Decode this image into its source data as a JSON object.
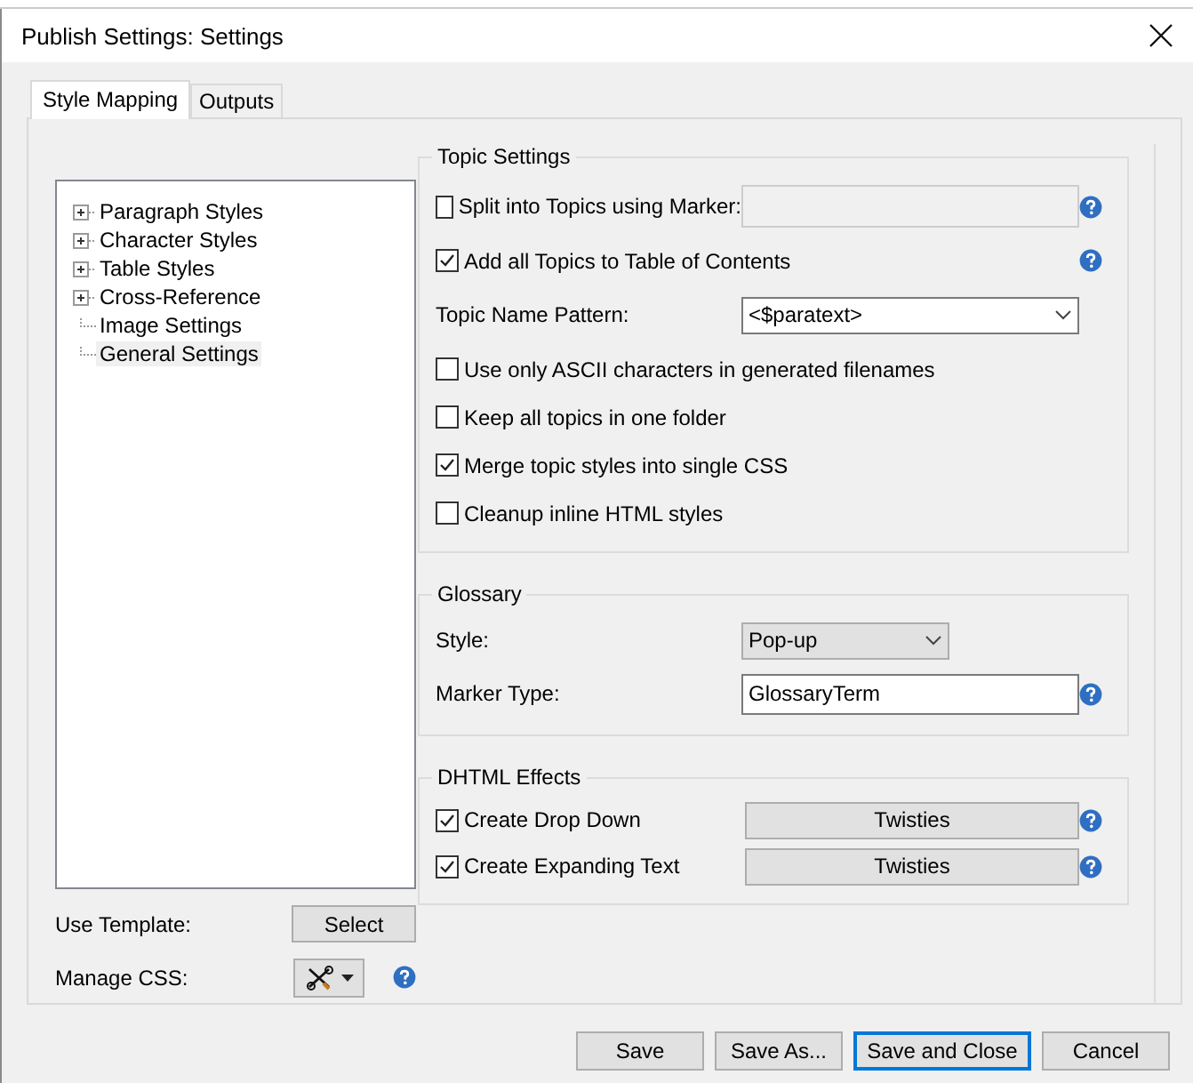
{
  "window": {
    "title": "Publish Settings: Settings"
  },
  "tabs": [
    {
      "label": "Style Mapping",
      "selected": true
    },
    {
      "label": "Outputs",
      "selected": false
    }
  ],
  "tree": {
    "items": [
      {
        "label": "Paragraph Styles",
        "kind": "group",
        "expanded": false,
        "selected": false
      },
      {
        "label": "Character Styles",
        "kind": "group",
        "expanded": false,
        "selected": false
      },
      {
        "label": "Table Styles",
        "kind": "group",
        "expanded": false,
        "selected": false
      },
      {
        "label": "Cross-Reference",
        "kind": "group",
        "expanded": false,
        "selected": false
      },
      {
        "label": "Image Settings",
        "kind": "leaf",
        "selected": false
      },
      {
        "label": "General Settings",
        "kind": "leaf",
        "selected": true
      }
    ]
  },
  "template": {
    "label": "Use Template:",
    "button": "Select"
  },
  "manage_css": {
    "label": "Manage CSS:",
    "help": true
  },
  "groups": [
    {
      "title": "Topic Settings",
      "rows": [
        {
          "kind": "checkbox",
          "label": "Split into Topics using Marker:",
          "checked": false,
          "field": {
            "disabled": true
          },
          "help": true
        },
        {
          "kind": "checkbox",
          "label": "Add all Topics to Table of Contents",
          "checked": true,
          "help": true
        },
        {
          "kind": "combo",
          "label": "Topic Name Pattern:",
          "value": "<$paratext>"
        },
        {
          "kind": "checkbox",
          "label": "Use only ASCII characters in generated filenames",
          "checked": false
        },
        {
          "kind": "checkbox",
          "label": "Keep all topics in one folder",
          "checked": false
        },
        {
          "kind": "checkbox",
          "label": "Merge topic styles into single CSS",
          "checked": true
        },
        {
          "kind": "checkbox",
          "label": "Cleanup inline HTML styles",
          "checked": false
        }
      ]
    },
    {
      "title": "Glossary",
      "rows": [
        {
          "kind": "dropdown",
          "label": "Style:",
          "value": "Pop-up"
        },
        {
          "kind": "text",
          "label": "Marker Type:",
          "value": "GlossaryTerm",
          "help": true
        }
      ]
    },
    {
      "title": "DHTML Effects",
      "rows": [
        {
          "kind": "checkbox",
          "label": "Create Drop Down",
          "checked": true,
          "button": "Twisties",
          "help": true
        },
        {
          "kind": "checkbox",
          "label": "Create Expanding Text",
          "checked": true,
          "button": "Twisties",
          "help": true
        }
      ]
    }
  ],
  "buttons": [
    {
      "label": "Save",
      "default": false
    },
    {
      "label": "Save As...",
      "default": false
    },
    {
      "label": "Save and Close",
      "default": true
    },
    {
      "label": "Cancel",
      "default": false
    }
  ]
}
